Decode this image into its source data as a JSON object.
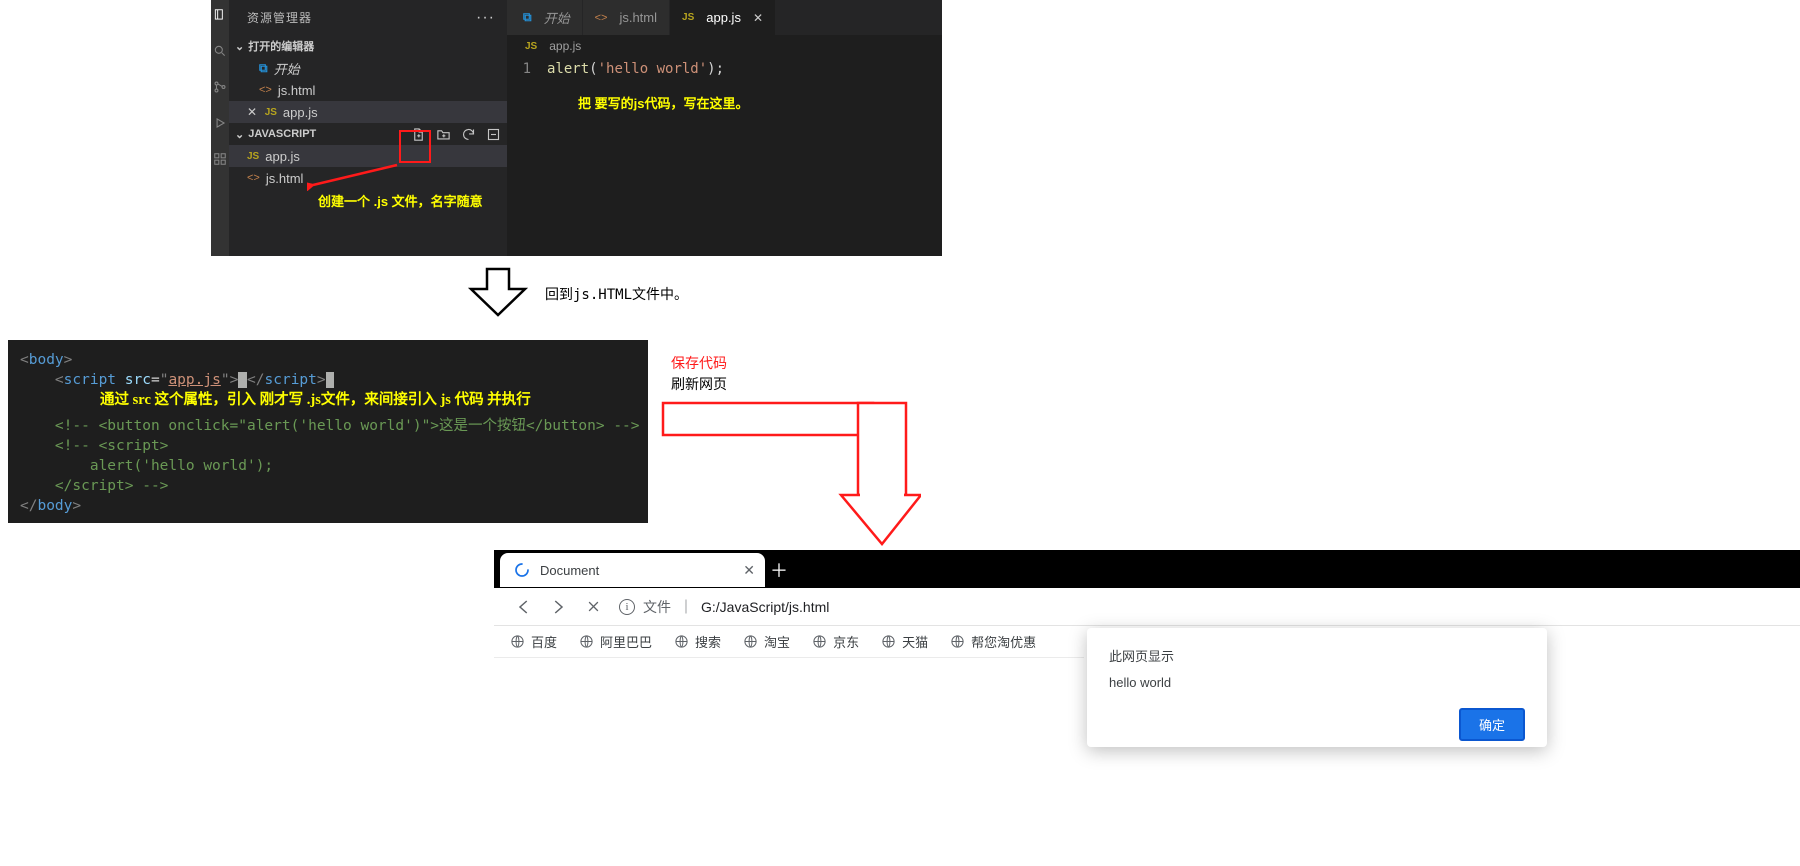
{
  "vscode": {
    "explorer_title": "资源管理器",
    "open_editors": "打开的编辑器",
    "project": "JAVASCRIPT",
    "files": {
      "start": "开始",
      "jshtml": "js.html",
      "appjs": "app.js"
    },
    "tabs": [
      {
        "icon": "vs",
        "label": "开始"
      },
      {
        "icon": "html",
        "label": "js.html"
      },
      {
        "icon": "js",
        "label": "app.js",
        "active": true
      }
    ],
    "crumb": "app.js",
    "code": {
      "line": "1",
      "fn": "alert",
      "str": "'hello world'"
    },
    "annotation_editor": "把 要写的js代码，写在这里。",
    "annotation_tree": "创建一个 .js 文件，名字随意"
  },
  "step1": "回到js.HTML文件中。",
  "code2": {
    "body_open": "body",
    "script": "script",
    "src": "src",
    "srcval": "app.js",
    "ann": "通过 src 这个属性，引入 刚才写 .js文件，来间接引入 js 代码 并执行",
    "cmt1": "<!-- <button onclick=\"alert('hello world')\">这是一个按钮</button> -->",
    "cmt2a": "<!-- <script>",
    "cmt2b": "    alert('hello world');",
    "cmt2c": "</script> -->",
    "body_close": "body"
  },
  "labels": {
    "save": "保存代码",
    "refresh": "刷新网页"
  },
  "browser": {
    "tab": "Document",
    "url_label": "文件",
    "url_path": "G:/JavaScript/js.html",
    "bookmarks": [
      "百度",
      "阿里巴巴",
      "搜索",
      "淘宝",
      "京东",
      "天猫",
      "帮您淘优惠"
    ]
  },
  "alert": {
    "title": "此网页显示",
    "msg": "hello world",
    "ok": "确定"
  }
}
